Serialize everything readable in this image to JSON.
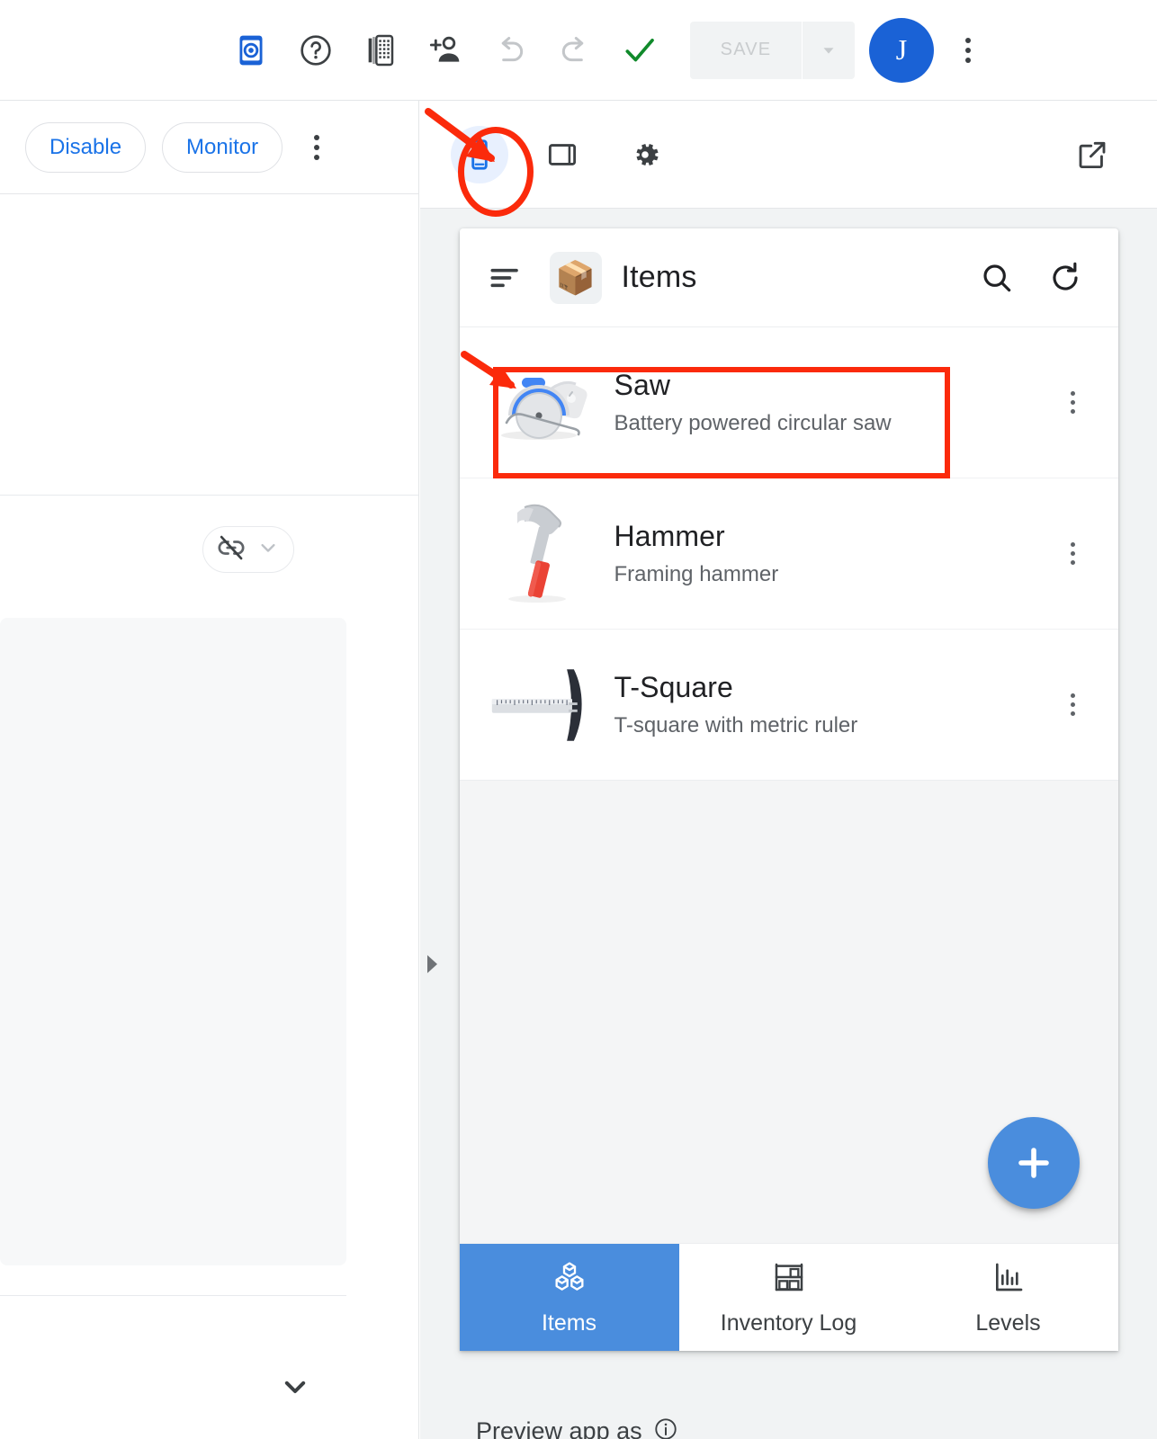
{
  "top_toolbar": {
    "icons": [
      {
        "name": "preview-eye-icon",
        "label": "Preview"
      },
      {
        "name": "help-icon",
        "label": "Help"
      },
      {
        "name": "test-device-icon",
        "label": "Test"
      },
      {
        "name": "add-person-icon",
        "label": "Share"
      },
      {
        "name": "undo-icon",
        "label": "Undo"
      },
      {
        "name": "redo-icon",
        "label": "Redo"
      },
      {
        "name": "checkmark-icon",
        "label": "Validated"
      }
    ],
    "save_label": "SAVE",
    "save_enabled": false,
    "avatar_initial": "J",
    "overflow_label": "More options"
  },
  "left_panel": {
    "disable_label": "Disable",
    "monitor_label": "Monitor",
    "overflow_label": "More",
    "link_off_label": "Not linked",
    "expand_chevron_label": "Expand"
  },
  "preview_toolbar": {
    "buttons": [
      {
        "name": "phone-preview-icon",
        "label": "Phone",
        "active": true
      },
      {
        "name": "tablet-preview-icon",
        "label": "Tablet",
        "active": false
      },
      {
        "name": "preview-settings-icon",
        "label": "Settings",
        "active": false
      }
    ],
    "open_external_label": "Open in new window"
  },
  "app_preview": {
    "app_bar": {
      "menu_label": "Menu",
      "logo_emoji": "📦",
      "title": "Items",
      "search_label": "Search",
      "refresh_label": "Refresh"
    },
    "items": [
      {
        "name": "Saw",
        "description": "Battery powered circular saw",
        "icon": "circular-saw-icon",
        "highlighted": true
      },
      {
        "name": "Hammer",
        "description": "Framing hammer",
        "icon": "hammer-icon",
        "highlighted": false
      },
      {
        "name": "T-Square",
        "description": "T-square with metric ruler",
        "icon": "t-square-icon",
        "highlighted": false
      }
    ],
    "fab_label": "Add item",
    "bottom_nav": [
      {
        "label": "Items",
        "icon": "boxes-icon",
        "active": true
      },
      {
        "label": "Inventory Log",
        "icon": "shelf-icon",
        "active": false
      },
      {
        "label": "Levels",
        "icon": "bar-chart-icon",
        "active": false
      }
    ]
  },
  "footer": {
    "preview_as_label": "Preview app as",
    "info_label": "Info"
  },
  "colors": {
    "accent_blue": "#1a73e8",
    "avatar_blue": "#1a62d6",
    "app_blue": "#4a8ddd",
    "annotation_red": "#fb2a0b",
    "check_green": "#108a2b",
    "text_primary": "#202124",
    "text_secondary": "#5f6368"
  }
}
